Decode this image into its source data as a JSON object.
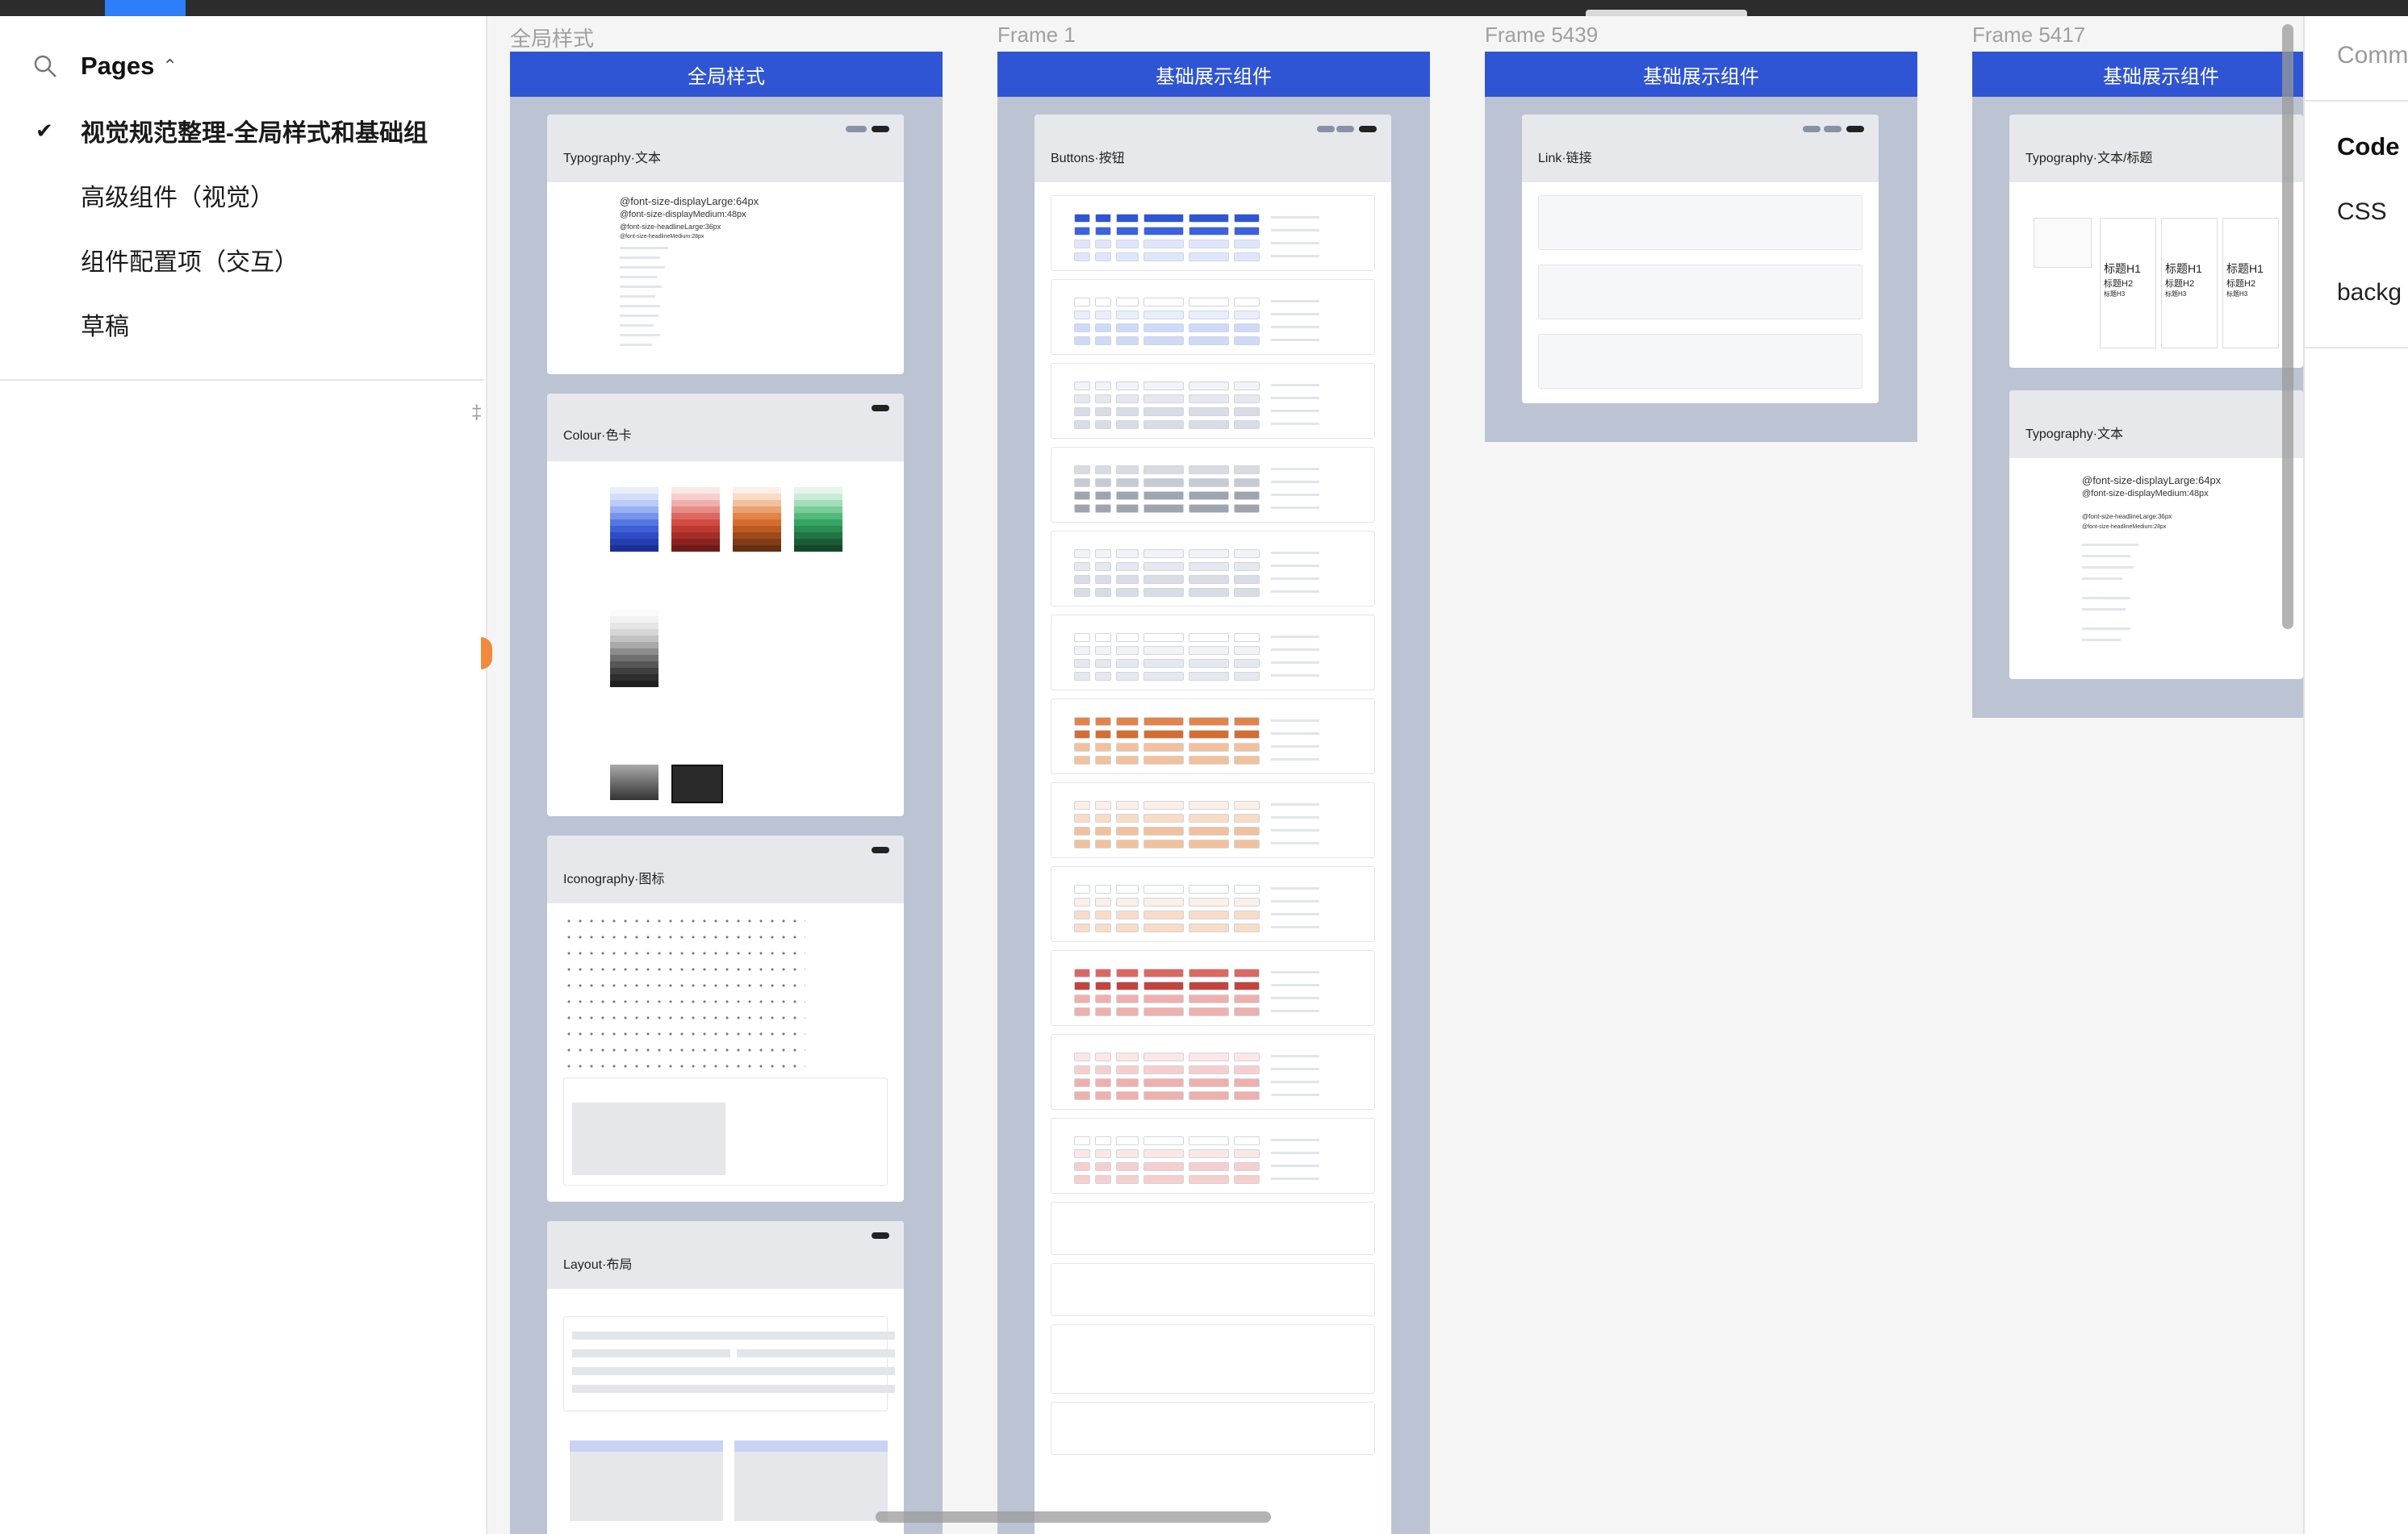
{
  "sidebar": {
    "pages_label": "Pages",
    "pages": [
      {
        "label": "视觉规范整理-全局样式和基础组",
        "current": true
      },
      {
        "label": "高级组件（视觉）",
        "current": false
      },
      {
        "label": "组件配置项（交互）",
        "current": false
      },
      {
        "label": "草稿",
        "current": false
      }
    ]
  },
  "canvas": {
    "frames": [
      {
        "name": "全局样式",
        "header": "全局样式"
      },
      {
        "name": "Frame 1",
        "header": "基础展示组件"
      },
      {
        "name": "Frame 5439",
        "header": "基础展示组件"
      },
      {
        "name": "Frame 5417",
        "header": "基础展示组件"
      }
    ],
    "cards": {
      "typography": {
        "title": "Typography·文本",
        "lines": [
          "@font-size-displayLarge:64px",
          "@font-size-displayMedium:48px",
          "@font-size-headlineLarge:36px",
          "@font-size-headlineMedium:28px"
        ]
      },
      "colour": {
        "title": "Colour·色卡"
      },
      "iconography": {
        "title": "Iconography·图标"
      },
      "layout": {
        "title": "Layout·布局"
      },
      "buttons": {
        "title": "Buttons·按钮"
      },
      "link": {
        "title": "Link·链接"
      },
      "typography_heading": {
        "title": "Typography·文本/标题",
        "heading_lines": [
          "标题H1",
          "标题H2",
          "标题H3"
        ]
      },
      "typography_text": {
        "title": "Typography·文本",
        "lines": [
          "@font-size-displayLarge:64px",
          "@font-size-displayMedium:48px",
          "@font-size-headlineLarge:36px",
          "@font-size-headlineMedium:28px"
        ]
      }
    }
  },
  "inspector": {
    "tab_label": "Comm",
    "code_heading": "Code",
    "css_label": "CSS",
    "background_prop": "backg"
  },
  "colors": {
    "frame_header": "#2f55d4",
    "frame_bg": "#bcc3d2",
    "accent_tab": "#2d7ff9"
  }
}
